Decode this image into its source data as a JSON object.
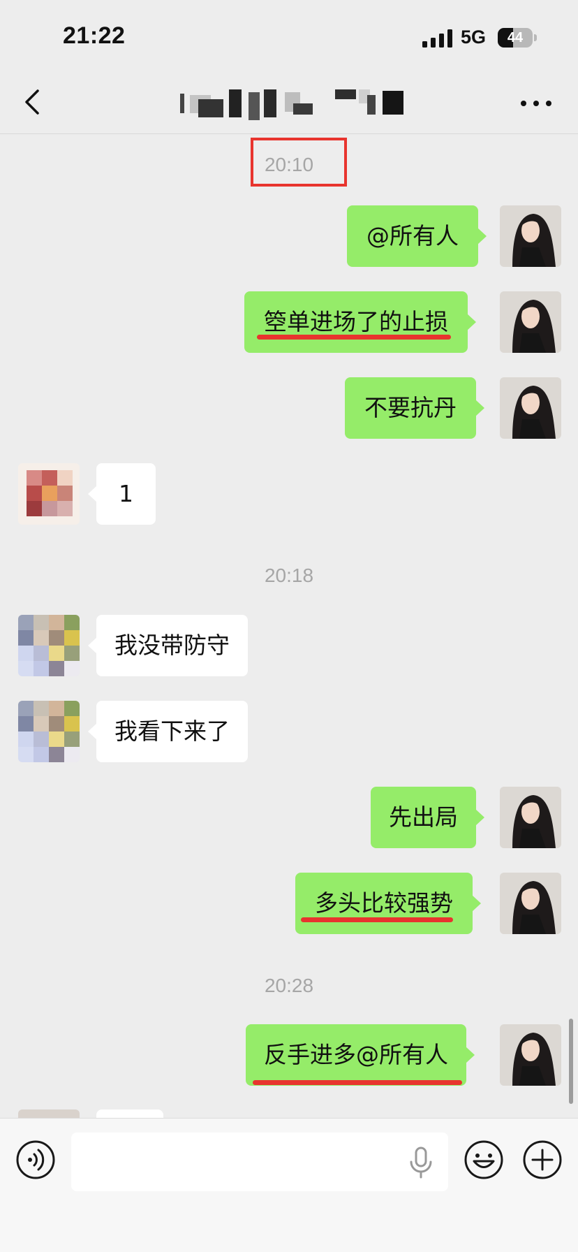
{
  "status_bar": {
    "time": "21:22",
    "network": "5G",
    "battery_level": "44",
    "battery_fraction": 0.44
  },
  "nav": {
    "title": "",
    "back_icon": "chevron-left-icon",
    "more_icon": "more-horizontal-icon"
  },
  "colors": {
    "outgoing_bubble": "#95ec69",
    "incoming_bubble": "#ffffff",
    "annotation_red": "#e8342e",
    "background": "#ededed"
  },
  "timestamps": [
    "20:10",
    "20:18",
    "20:28"
  ],
  "messages": [
    {
      "sender": "self",
      "text": "@所有人",
      "underlined": false
    },
    {
      "sender": "self",
      "text": "箜单进场了的止损",
      "underlined": true
    },
    {
      "sender": "self",
      "text": "不要抗丹",
      "underlined": false
    },
    {
      "sender": "other",
      "text": "1",
      "underlined": false
    },
    {
      "sender": "other",
      "text": "我没带防守",
      "underlined": false
    },
    {
      "sender": "other",
      "text": "我看下来了",
      "underlined": false
    },
    {
      "sender": "self",
      "text": "先出局",
      "underlined": false
    },
    {
      "sender": "self",
      "text": "多头比较强势",
      "underlined": true
    },
    {
      "sender": "self",
      "text": "反手进多@所有人",
      "underlined": true
    }
  ],
  "input_bar": {
    "placeholder": "",
    "voice_icon": "voice-icon",
    "mic_icon": "microphone-icon",
    "emoji_icon": "emoji-icon",
    "plus_icon": "plus-icon"
  }
}
